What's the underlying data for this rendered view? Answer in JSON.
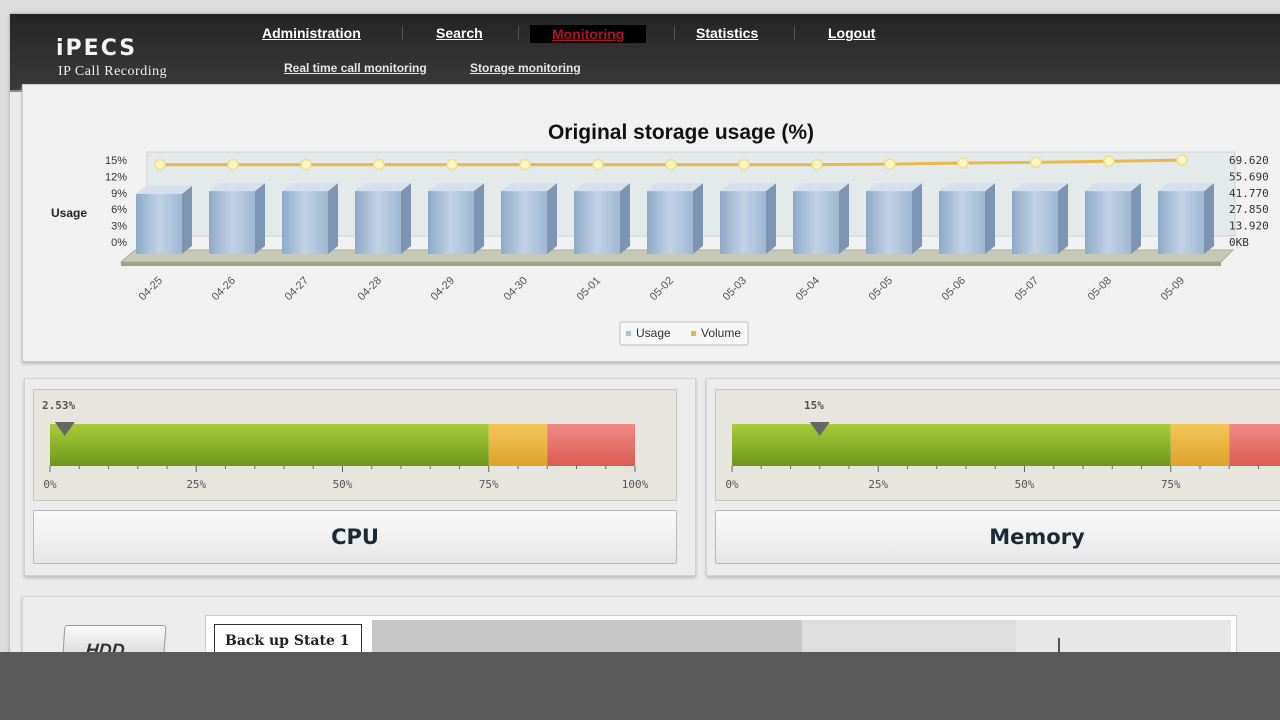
{
  "header": {
    "logo": "iPECS",
    "logo_sub": "IP Call Recording",
    "nav": {
      "administration": "Administration",
      "search": "Search",
      "monitoring": "Monitoring",
      "statistics": "Statistics",
      "logout": "Logout"
    },
    "subnav": {
      "realtime": "Real time call monitoring",
      "storage": "Storage monitoring"
    }
  },
  "chart_data": {
    "type": "bar",
    "title": "Original storage usage (%)",
    "ylabel": "Usage",
    "categories": [
      "04-25",
      "04-26",
      "04-27",
      "04-28",
      "04-29",
      "04-30",
      "05-01",
      "05-02",
      "05-03",
      "05-04",
      "05-05",
      "05-06",
      "05-07",
      "05-08",
      "05-09"
    ],
    "y_ticks": [
      "15%",
      "12%",
      "9%",
      "6%",
      "3%",
      "0%"
    ],
    "y2_ticks": [
      "69.620",
      "55.690",
      "41.770",
      "27.850",
      "13.920",
      "0KB"
    ],
    "ylim": [
      0,
      15
    ],
    "series": [
      {
        "name": "Usage",
        "type": "bar",
        "color": "#a9c0da",
        "values": [
          11,
          11.5,
          11.5,
          11.5,
          11.5,
          11.5,
          11.5,
          11.5,
          11.5,
          11.5,
          11.5,
          11.5,
          11.5,
          11.5,
          11.5
        ]
      },
      {
        "name": "Volume",
        "type": "line",
        "color": "#e8b94a",
        "values": [
          14.0,
          14.0,
          14.0,
          14.0,
          14.0,
          14.0,
          14.0,
          14.0,
          14.0,
          14.0,
          14.1,
          14.3,
          14.4,
          14.6,
          14.8
        ]
      }
    ],
    "legend": "bottom-center",
    "legend_items": [
      "Usage",
      "Volume"
    ]
  },
  "gauges": [
    {
      "name": "CPU",
      "value_label": "2.53%",
      "value": 2.53,
      "ticks": [
        "0%",
        "25%",
        "50%",
        "75%",
        "100%"
      ]
    },
    {
      "name": "Memory",
      "value_label": "15%",
      "value": 15,
      "ticks": [
        "0%",
        "25%",
        "50%",
        "75%"
      ]
    }
  ],
  "colors": {
    "green": "#8fb52a",
    "yellow": "#e8b13a",
    "red": "#e66a64"
  },
  "backup": {
    "label": "Back up State 1",
    "hdd_label": "HDD"
  }
}
